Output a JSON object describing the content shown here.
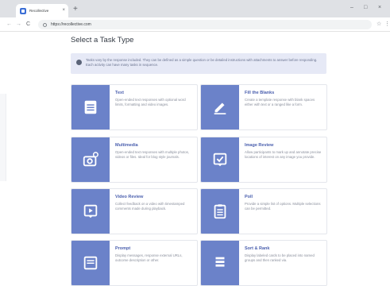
{
  "browser": {
    "tab_title": "Recollective",
    "tab_close": "×",
    "new_tab": "+",
    "minimize": "–",
    "maximize": "□",
    "close": "×",
    "back": "←",
    "forward": "→",
    "reload": "C",
    "url": "https://recollective.com",
    "star": "☆",
    "menu": "⋮"
  },
  "page": {
    "heading": "Select a Task Type",
    "info_text": "Tasks vary by the response included. They can be defined as a simple question or be detailed instructions with attachments to answer before responding. Each activity can have many tasks in sequence."
  },
  "tasks": [
    {
      "title": "Text",
      "description": "Open-ended text responses with optional word limits, formatting and video images.",
      "icon": "text-icon"
    },
    {
      "title": "Fill the Blanks",
      "description": "Create a template response with blank spaces either with text or a ranged like a form.",
      "icon": "pen-icon"
    },
    {
      "title": "Multimedia",
      "description": "Open-ended text responses with multiple photos, videos or files. Ideal for blog style journals.",
      "icon": "camera-icon"
    },
    {
      "title": "Image Review",
      "description": "Allow participants to mark up and annotate precise locations of interest on any image you provide.",
      "icon": "image-review-icon"
    },
    {
      "title": "Video Review",
      "description": "Collect feedback on a video with timestamped comments made during playback.",
      "icon": "video-review-icon"
    },
    {
      "title": "Poll",
      "description": "Provide a simple list of options. Multiple selections can be permitted.",
      "icon": "clipboard-icon"
    },
    {
      "title": "Prompt",
      "description": "Display messages, response external URLs, outcome description or other.",
      "icon": "prompt-icon"
    },
    {
      "title": "Sort & Rank",
      "description": "Display labeled cards to be placed into named groups and then ranked via.",
      "icon": "sort-icon"
    }
  ],
  "colors": {
    "accent": "#6b82c9",
    "title": "#4a5fae",
    "info_bg": "#e6e9f6"
  }
}
